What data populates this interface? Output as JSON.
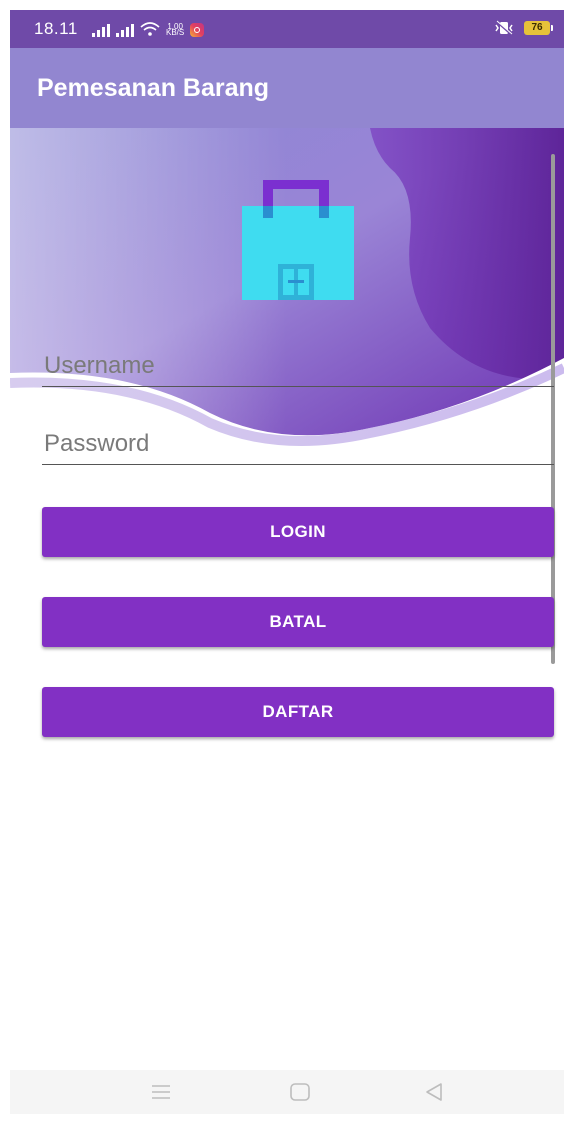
{
  "status_bar": {
    "time": "18.11",
    "net_speed_value": "1.00",
    "net_speed_unit": "KB/S",
    "battery": "76"
  },
  "app_bar": {
    "title": "Pemesanan Barang"
  },
  "login_form": {
    "username_placeholder": "Username",
    "password_placeholder": "Password",
    "login_label": "LOGIN",
    "cancel_label": "BATAL",
    "register_label": "DAFTAR"
  },
  "icons": {
    "header": "shopping-bag-icon",
    "nav": [
      "menu-icon",
      "home-icon",
      "back-icon"
    ]
  },
  "colors": {
    "status_bar": "#6f4aa8",
    "app_bar": "#9286d0",
    "button": "#8230c4",
    "bag_body": "#3fdcf0",
    "bag_handle": "#7b2fd0"
  }
}
